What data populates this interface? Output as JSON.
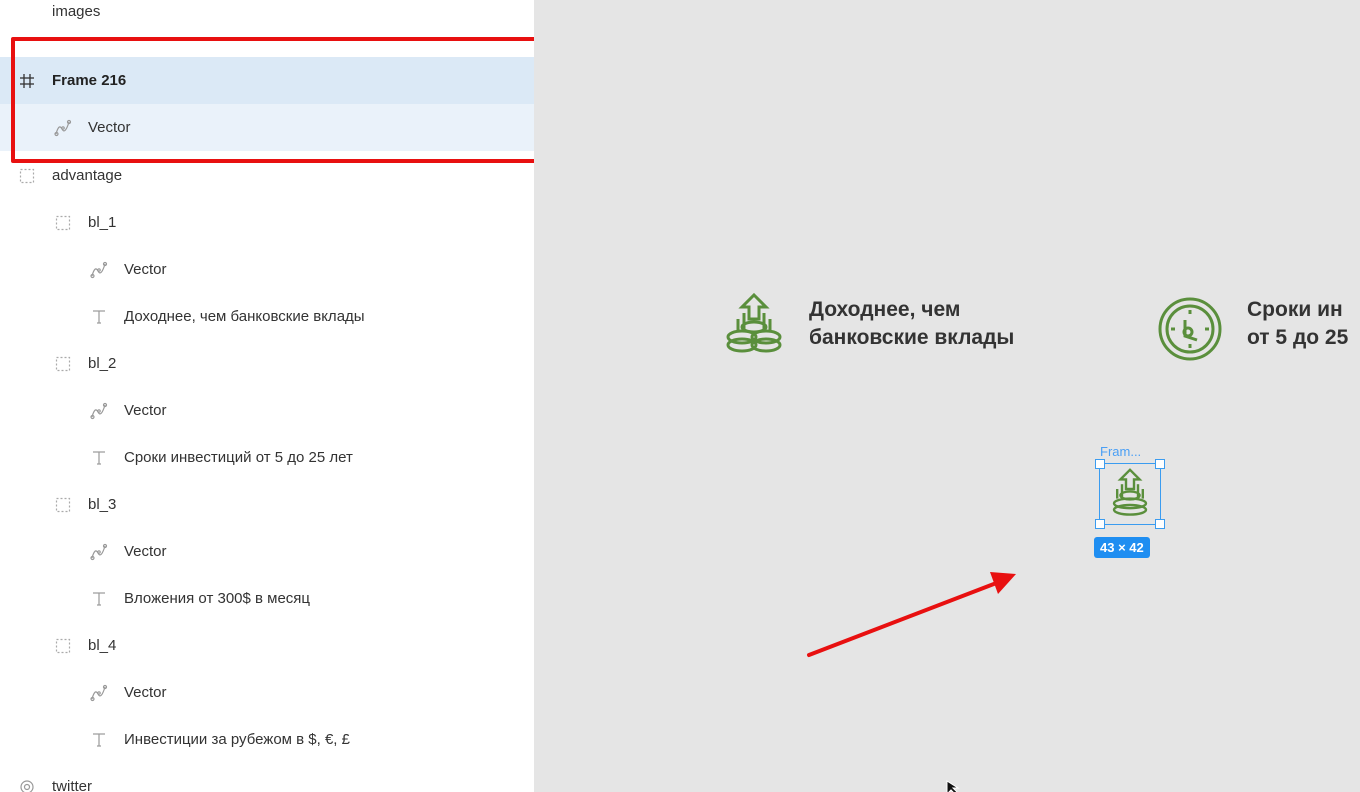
{
  "layers": [
    {
      "label": "images",
      "icon": "none-icon",
      "indent": 0,
      "state": "normal"
    },
    {
      "label": "Frame 216",
      "icon": "frame-icon",
      "indent": 0,
      "state": "selected",
      "bold": true
    },
    {
      "label": "Vector",
      "icon": "vector-icon",
      "indent": 1,
      "state": "selected-child"
    },
    {
      "label": "advantage",
      "icon": "group-icon",
      "indent": 0,
      "state": "normal"
    },
    {
      "label": "bl_1",
      "icon": "group-icon",
      "indent": 1,
      "state": "normal"
    },
    {
      "label": "Vector",
      "icon": "vector-icon",
      "indent": 2,
      "state": "normal"
    },
    {
      "label": "Доходнее, чем банковские вклады",
      "icon": "text-icon",
      "indent": 2,
      "state": "normal"
    },
    {
      "label": "bl_2",
      "icon": "group-icon",
      "indent": 1,
      "state": "normal"
    },
    {
      "label": "Vector",
      "icon": "vector-icon",
      "indent": 2,
      "state": "normal"
    },
    {
      "label": "Сроки инвестиций от 5 до 25 лет",
      "icon": "text-icon",
      "indent": 2,
      "state": "normal"
    },
    {
      "label": "bl_3",
      "icon": "group-icon",
      "indent": 1,
      "state": "normal"
    },
    {
      "label": "Vector",
      "icon": "vector-icon",
      "indent": 2,
      "state": "normal"
    },
    {
      "label": "Вложения от 300$ в месяц",
      "icon": "text-icon",
      "indent": 2,
      "state": "normal"
    },
    {
      "label": "bl_4",
      "icon": "group-icon",
      "indent": 1,
      "state": "normal"
    },
    {
      "label": "Vector",
      "icon": "vector-icon",
      "indent": 2,
      "state": "normal"
    },
    {
      "label": "Инвестиции за рубежом в $, €, £",
      "icon": "text-icon",
      "indent": 2,
      "state": "normal"
    },
    {
      "label": "twitter",
      "icon": "component-icon",
      "indent": 0,
      "state": "normal"
    }
  ],
  "canvas": {
    "adv1_line1": "Доходнее, чем",
    "adv1_line2": "банковские вклады",
    "adv2_line1": "Сроки ин",
    "adv2_line2": "от 5 до 25",
    "frame_label": "Fram...",
    "size_badge": "43 × 42"
  },
  "colors": {
    "icon_green": "#5a8f3c",
    "selection_blue": "#3b9cf0",
    "annotation_red": "#e81010",
    "selected_row": "#dbe9f6",
    "selected_child_row": "#eaf2fa",
    "canvas_bg": "#e5e5e5"
  }
}
